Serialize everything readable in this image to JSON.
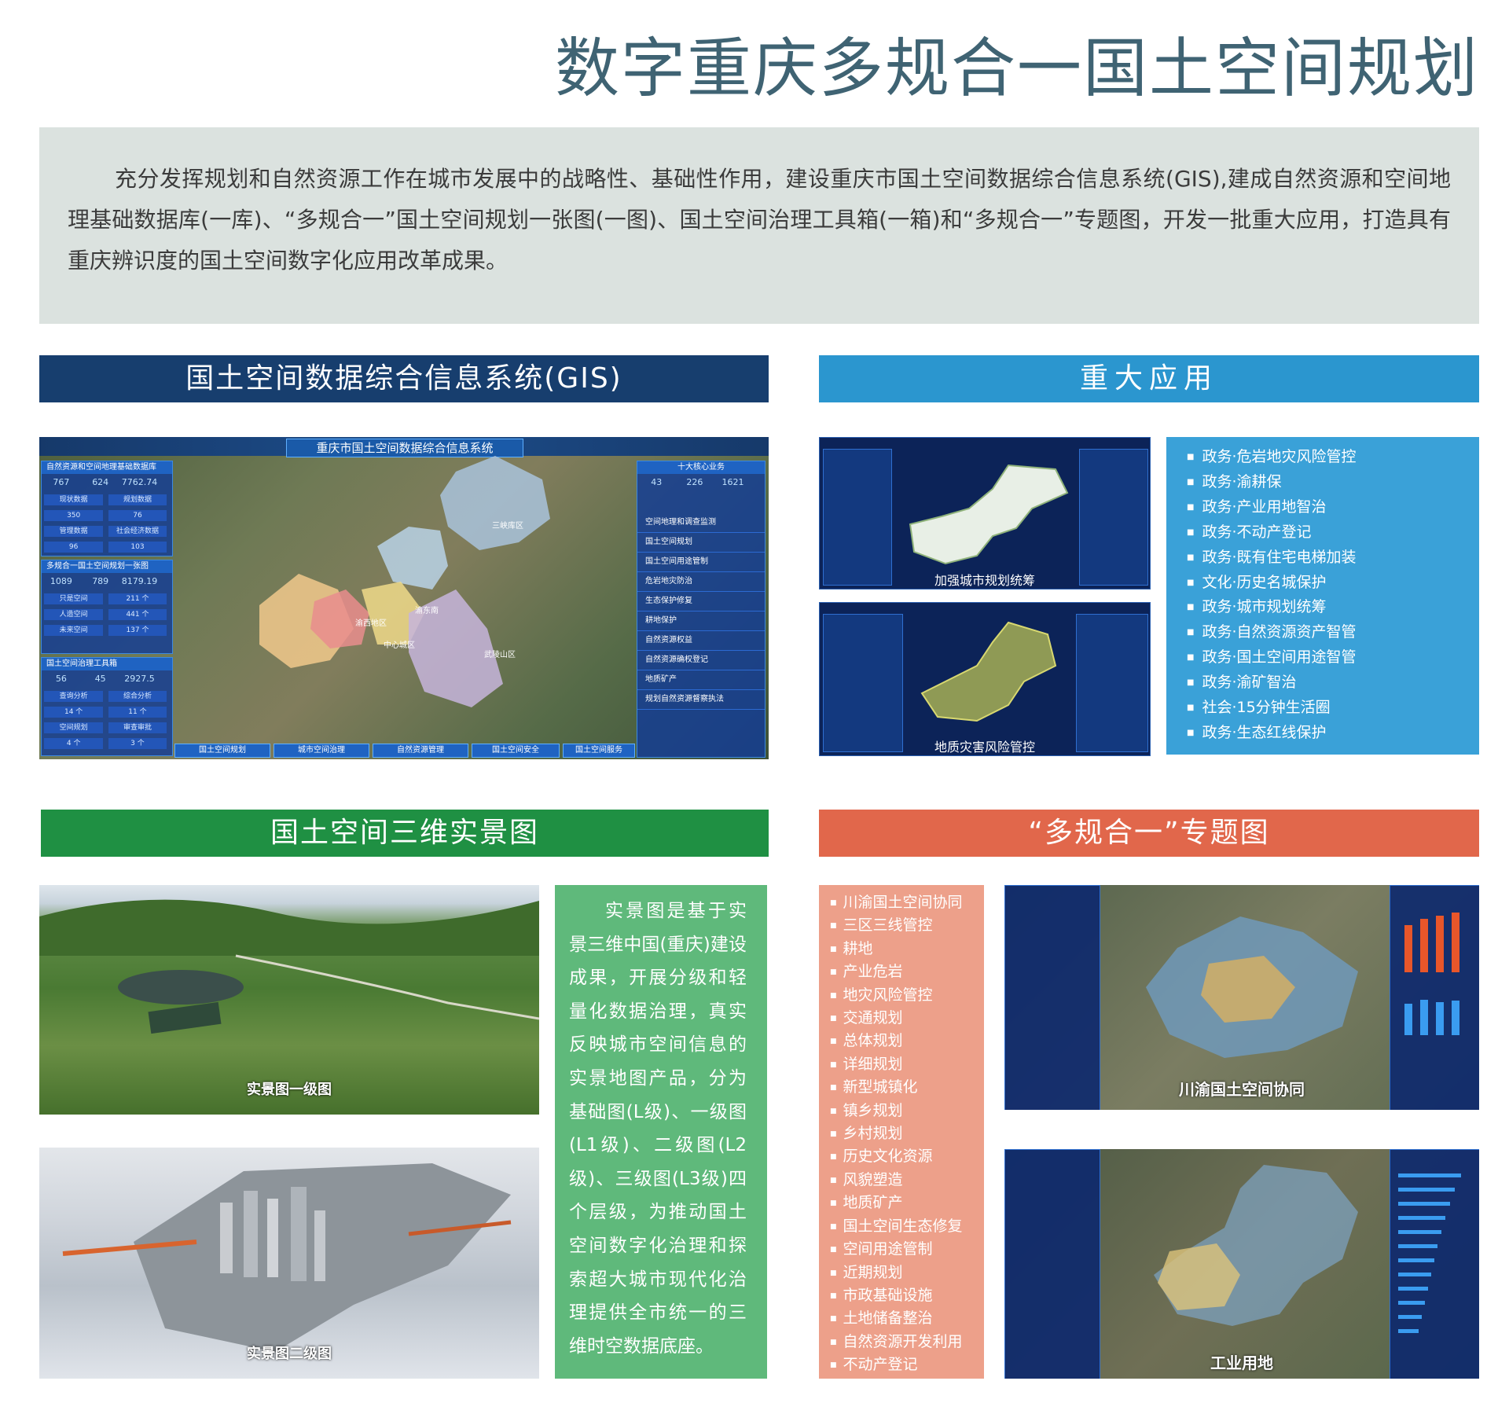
{
  "title": "数字重庆多规合一国土空间规划",
  "intro": "充分发挥规划和自然资源工作在城市发展中的战略性、基础性作用，建设重庆市国土空间数据综合信息系统(GIS),建成自然资源和空间地理基础数据库(一库)、“多规合一”国土空间规划一张图(一图)、国土空间治理工具箱(一箱)和“多规合一”专题图，开发一批重大应用，打造具有重庆辨识度的国土空间数字化应用改革成果。",
  "sections": {
    "gis": "国土空间数据综合信息系统(GIS)",
    "apps": "重大应用",
    "realscene": "国土空间三维实景图",
    "topic": "“多规合一”专题图"
  },
  "gis_screen": {
    "system_title": "重庆市国土空间数据综合信息系统",
    "left_panels": [
      {
        "head": "自然资源和空间地理基础数据库",
        "stats": [
          "767",
          "624",
          "7762.74"
        ],
        "cells": [
          "现状数据",
          "规划数据",
          "350",
          "76",
          "管理数据",
          "社会经济数据",
          "96",
          "103"
        ]
      },
      {
        "head": "多规合一国土空间规划一张图",
        "stats": [
          "1089",
          "789",
          "8179.19"
        ],
        "cells": [
          "只是空间",
          "211 个",
          "人造空间",
          "441 个",
          "未来空间",
          "137 个"
        ]
      },
      {
        "head": "国土空间治理工具箱",
        "stats": [
          "56",
          "45",
          "2927.5"
        ],
        "cells": [
          "查询分析",
          "综合分析",
          "14 个",
          "11 个",
          "空间规划",
          "审查审批",
          "4 个",
          "3 个"
        ]
      }
    ],
    "right_panel_head": "十大核心业务",
    "right_stats": [
      "43",
      "226",
      "1621"
    ],
    "right_items": [
      "空间地理和调查监测",
      "国土空间规划",
      "国土空间用途管制",
      "危岩地灾防治",
      "生态保护修复",
      "耕地保护",
      "自然资源权益",
      "自然资源确权登记",
      "地质矿产",
      "规划自然资源督察执法"
    ],
    "bottom_tabs": [
      "国土空间规划",
      "城市空间治理",
      "自然资源管理",
      "国土空间安全",
      "国土空间服务"
    ],
    "map_labels": [
      "三峡库区",
      "渝西地区",
      "中心城区",
      "渝东南",
      "武陵山区"
    ]
  },
  "app_screens": {
    "shot1_caption": "加强城市规划统筹",
    "shot2_caption": "地质灾害风险管控"
  },
  "app_list": [
    "政务·危岩地灾风险管控",
    "政务·渝耕保",
    "政务·产业用地智治",
    "政务·不动产登记",
    "政务·既有住宅电梯加装",
    "文化·历史名城保护",
    "政务·城市规划统筹",
    "政务·自然资源资产智管",
    "政务·国土空间用途智管",
    "政务·渝矿智治",
    "社会·15分钟生活圈",
    "政务·生态红线保护"
  ],
  "realscene": {
    "img1_caption": "实景图一级图",
    "img2_caption": "实景图二级图",
    "description": "实景图是基于实景三维中国(重庆)建设成果，开展分级和轻量化数据治理，真实反映城市空间信息的实景地图产品，分为基础图(L级)、一级图(L1级)、二级图(L2级)、三级图(L3级)四个层级，为推动国土空间数字化治理和探索超大城市现代化治理提供全市统一的三维时空数据底座。"
  },
  "topic_list": [
    "川渝国土空间协同",
    "三区三线管控",
    "耕地",
    "产业危岩",
    "地灾风险管控",
    "交通规划",
    "总体规划",
    "详细规划",
    "新型城镇化",
    "镇乡规划",
    "乡村规划",
    "历史文化资源",
    "风貌塑造",
    "地质矿产",
    "国土空间生态修复",
    "空间用途管制",
    "近期规划",
    "市政基础设施",
    "土地储备整治",
    "自然资源开发利用",
    "不动产登记"
  ],
  "topic_screens": {
    "shot1_caption": "川渝国土空间协同",
    "shot2_caption": "工业用地"
  },
  "colors": {
    "gis_header": "#173e6e",
    "apps_header": "#2b96cf",
    "realscene_header": "#1f9043",
    "topic_header": "#e1674b"
  }
}
